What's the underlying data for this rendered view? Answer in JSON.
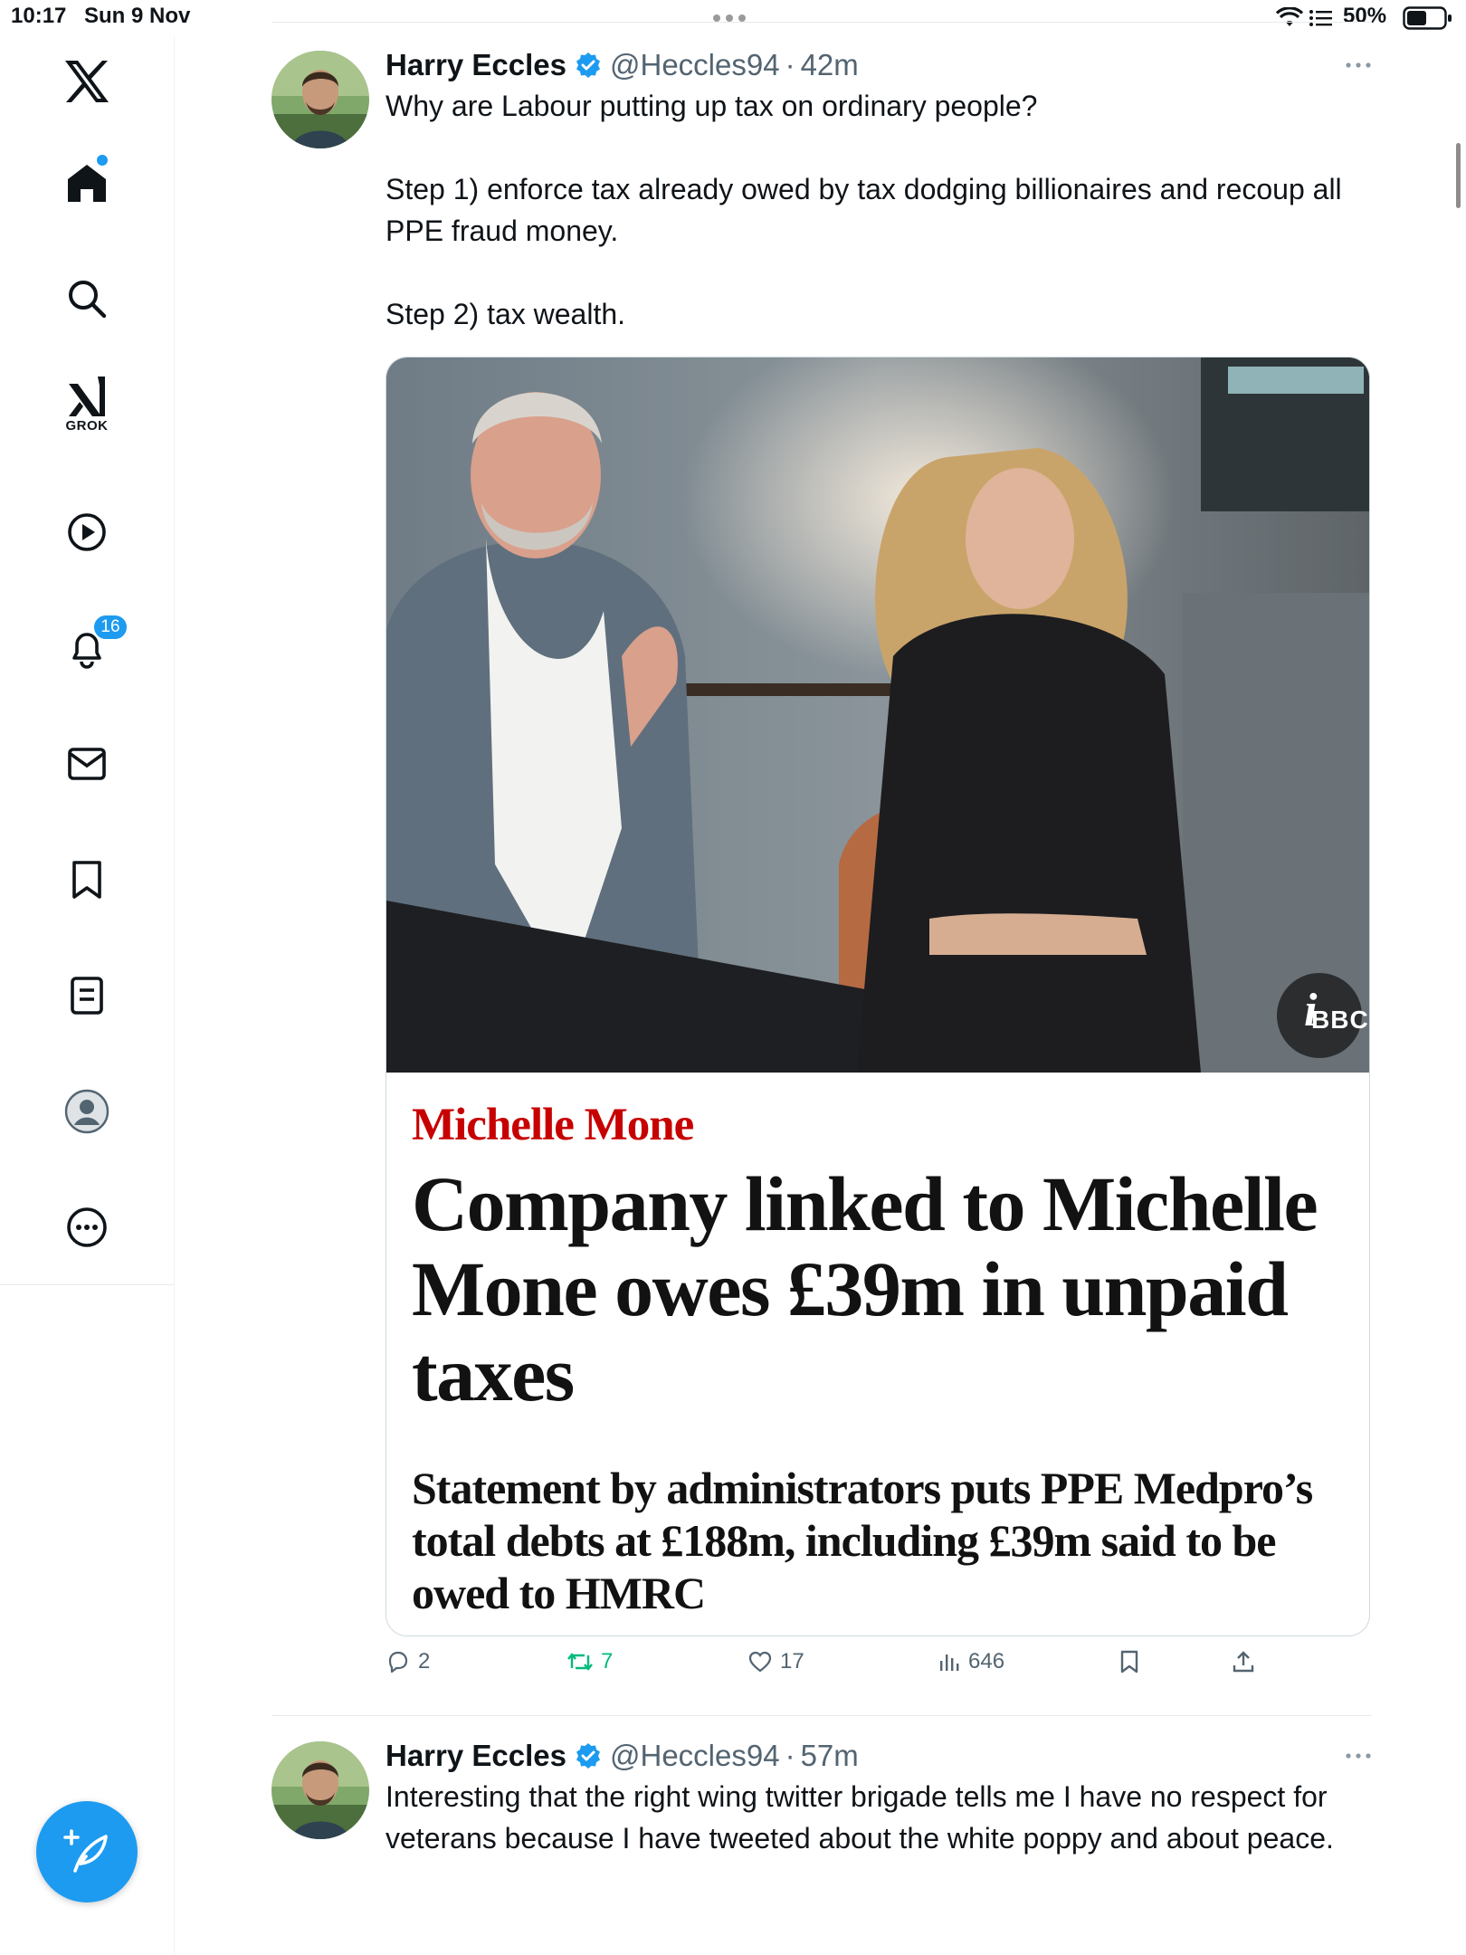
{
  "status_bar": {
    "time": "10:17",
    "date": "Sun 9 Nov",
    "battery": "50%"
  },
  "sidebar": {
    "items": [
      {
        "icon": "x-logo-icon"
      },
      {
        "icon": "home-icon",
        "has_new_dot": true
      },
      {
        "icon": "search-icon"
      },
      {
        "icon": "grok-icon",
        "label": "GROK"
      },
      {
        "icon": "video-play-icon"
      },
      {
        "icon": "bell-icon",
        "badge": "16"
      },
      {
        "icon": "mail-icon"
      },
      {
        "icon": "bookmark-icon"
      },
      {
        "icon": "lists-icon"
      },
      {
        "icon": "profile-icon"
      },
      {
        "icon": "more-circle-icon"
      }
    ],
    "compose_icon": "compose-feather-icon"
  },
  "feed": {
    "posts": [
      {
        "author": "Harry Eccles",
        "handle": "@Heccles94",
        "separator": "·",
        "time": "42m",
        "text": "Why are Labour putting up tax on ordinary people?\n\nStep 1) enforce tax already owed by tax dodging billionaires and recoup all PPE fraud money.\n\nStep 2) tax wealth.",
        "media": {
          "image_label": "BBC",
          "info_symbol": "i",
          "kicker": "Michelle Mone",
          "headline": "Company linked to Michelle Mone owes £39m in unpaid taxes",
          "standfirst": "Statement by administrators puts PPE Medpro’s total debts at £188m, including £39m said to be owed to HMRC"
        },
        "actions": {
          "replies": "2",
          "reposts": "7",
          "likes": "17",
          "views": "646"
        }
      },
      {
        "author": "Harry Eccles",
        "handle": "@Heccles94",
        "separator": "·",
        "time": "57m",
        "text": "Interesting that the right wing twitter brigade tells me I have no respect for veterans because I have tweeted about the white poppy and about peace."
      }
    ]
  },
  "colors": {
    "accent": "#1d9bf0",
    "secondary_text": "#536471",
    "repost_green": "#00ba7c",
    "guardian_red": "#c70000"
  }
}
